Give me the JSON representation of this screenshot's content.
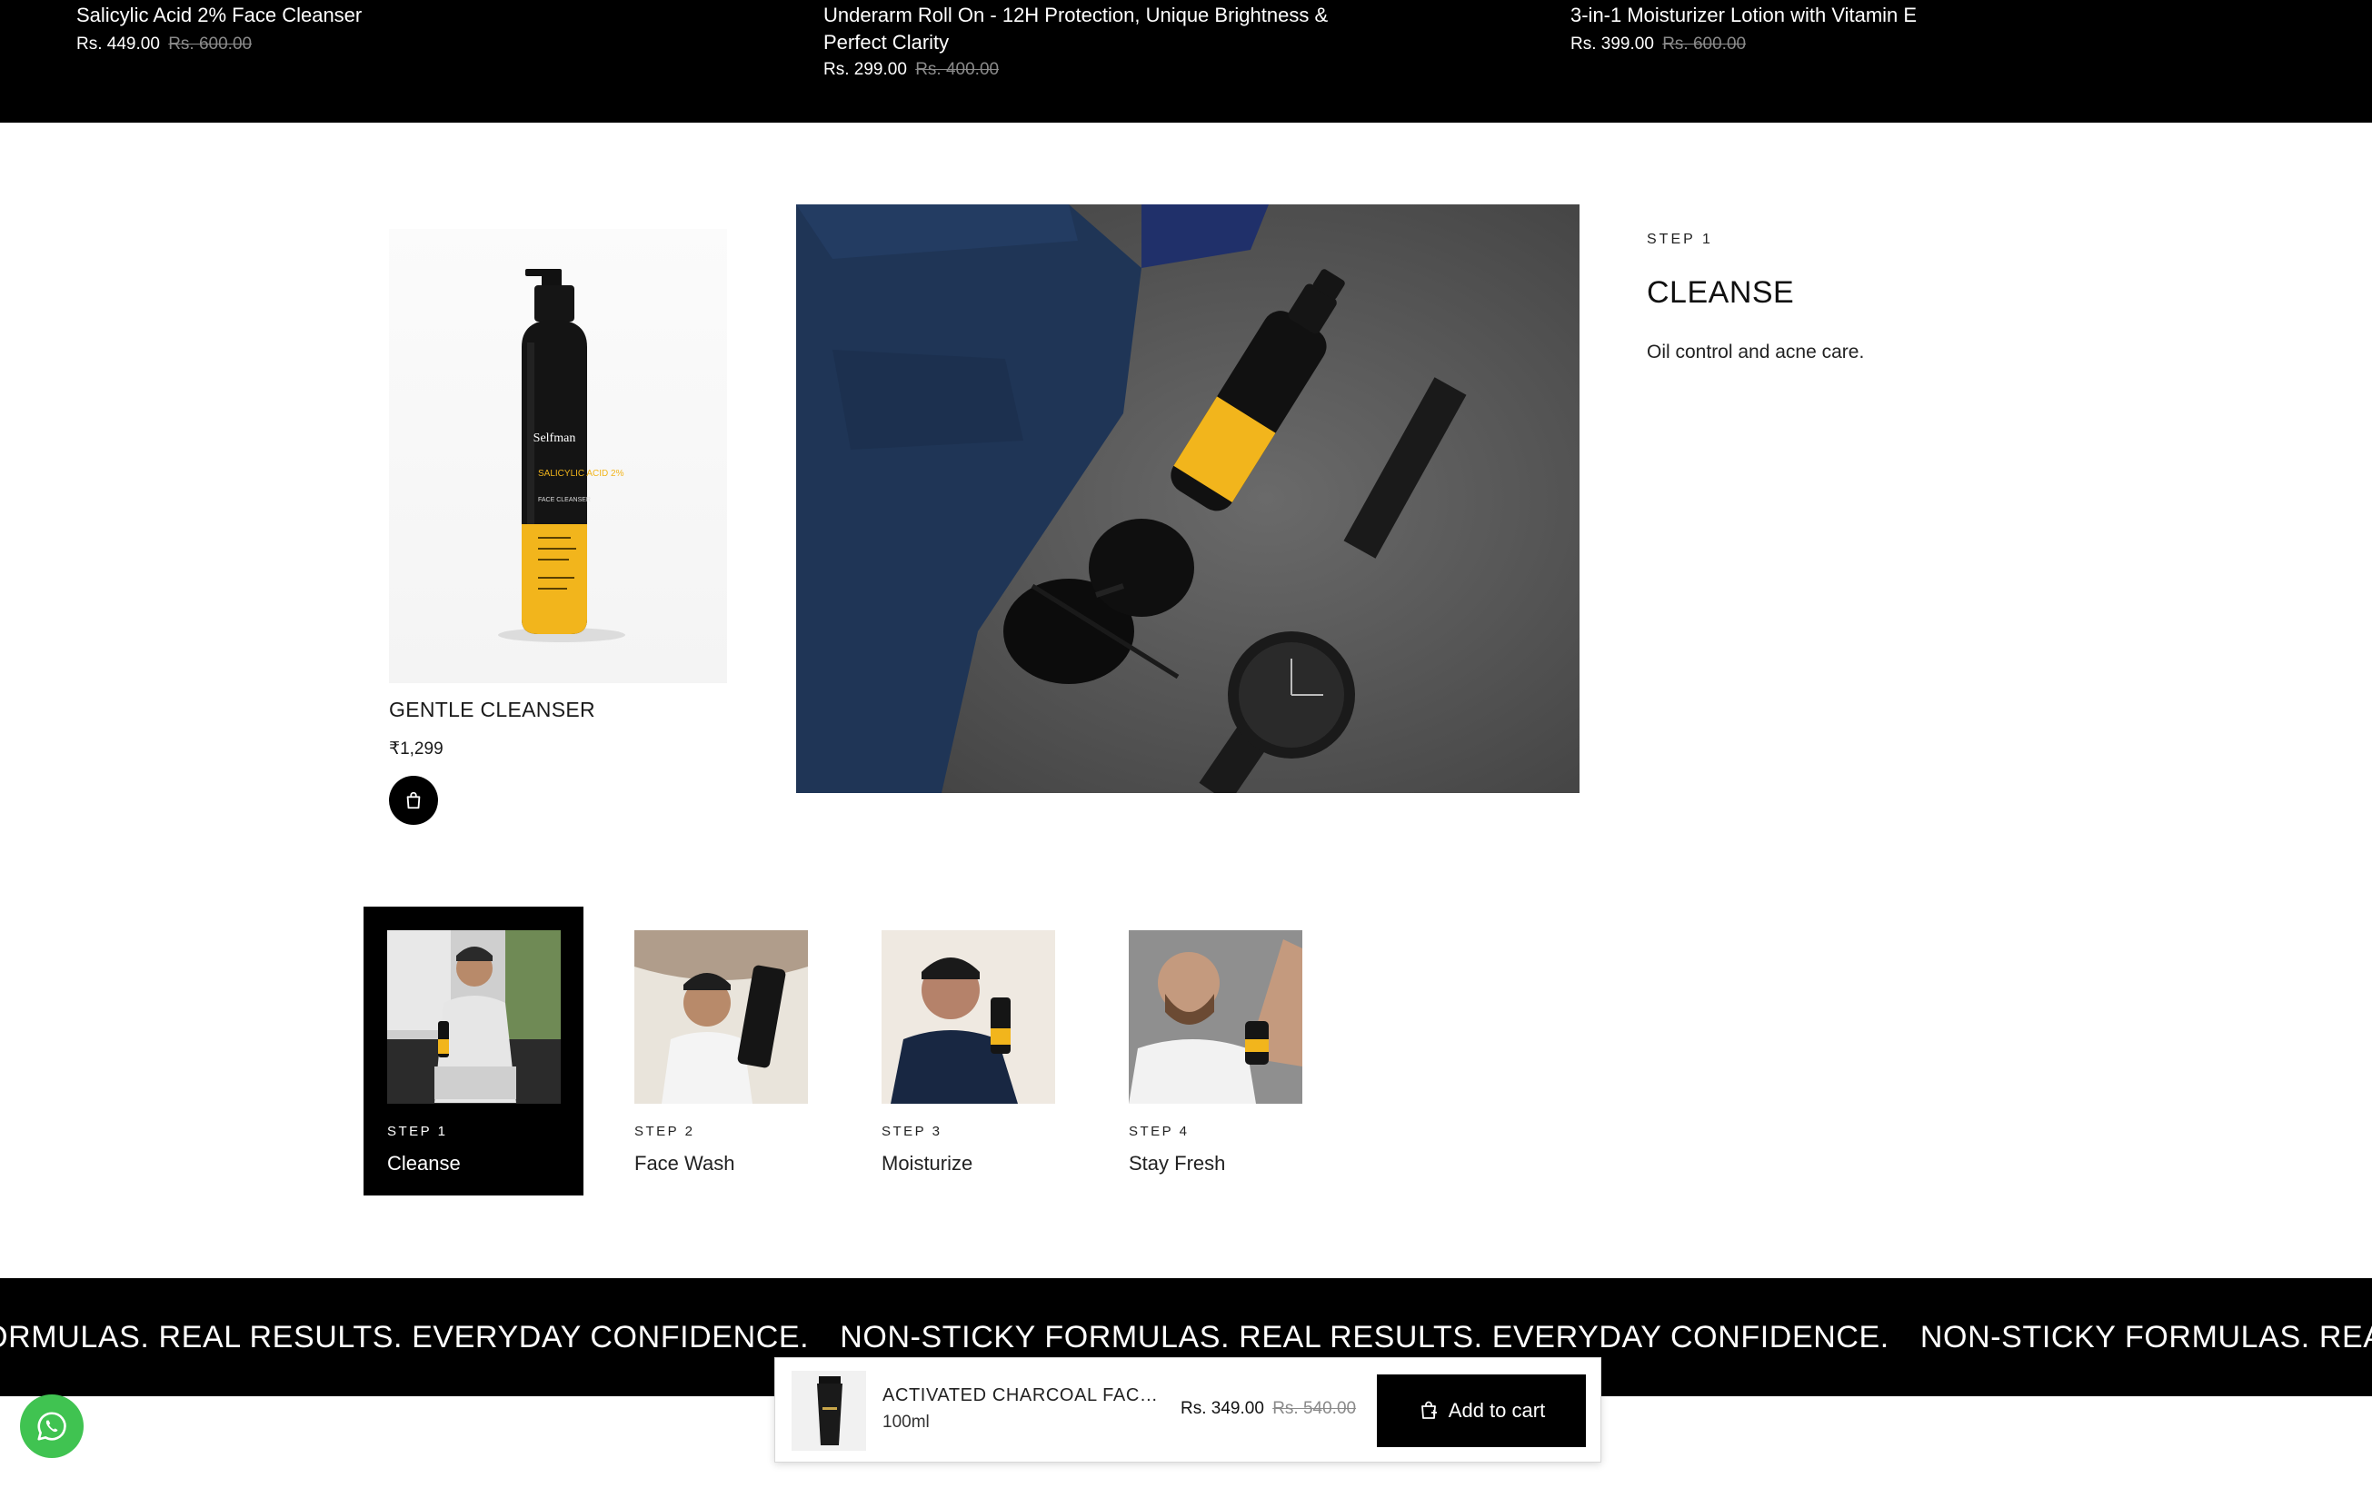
{
  "top_products": [
    {
      "name": "Salicylic Acid 2% Face Cleanser",
      "price": "Rs. 449.00",
      "old_price": "Rs. 600.00"
    },
    {
      "name": "Underarm Roll On - 12H Protection, Unique Brightness & Perfect Clarity",
      "price": "Rs. 299.00",
      "old_price": "Rs. 400.00"
    },
    {
      "name": "3-in-1 Moisturizer Lotion with Vitamin E",
      "price": "Rs. 399.00",
      "old_price": "Rs. 600.00"
    }
  ],
  "featured": {
    "product_name": "GENTLE CLEANSER",
    "product_price": "₹1,299",
    "bottle_brand": "Selfman",
    "bottle_label": "SALICYLIC ACID 2%",
    "bottle_sub": "FACE CLEANSER",
    "step_label": "STEP 1",
    "step_title": "CLEANSE",
    "step_description": "Oil control and acne care."
  },
  "steps": [
    {
      "label": "STEP 1",
      "name": "Cleanse",
      "active": true
    },
    {
      "label": "STEP 2",
      "name": "Face Wash",
      "active": false
    },
    {
      "label": "STEP 3",
      "name": "Moisturize",
      "active": false
    },
    {
      "label": "STEP 4",
      "name": "Stay Fresh",
      "active": false
    }
  ],
  "marquee": {
    "fragment_start": "Y FORMULAS. REAL RESULTS. EVERYDAY CONFIDENCE.",
    "phrase": "NON-STICKY FORMULAS. REAL RESULTS. EVERYDAY CONFIDENCE.",
    "fragment_end": "NON-STICKY FORMULAS. REAL"
  },
  "sticky_cart": {
    "product_name": "ACTIVATED CHARCOAL FACE ...",
    "size": "100ml",
    "price": "Rs. 349.00",
    "old_price": "Rs. 540.00",
    "button_label": "Add to cart"
  },
  "colors": {
    "black": "#000000",
    "accent_yellow": "#f2b51c",
    "whatsapp_green": "#40c351",
    "strike_gray": "#8a8a8a"
  },
  "icons": {
    "bag": "shopping-bag-icon",
    "cart": "cart-plus-icon",
    "chat": "whatsapp-icon"
  }
}
